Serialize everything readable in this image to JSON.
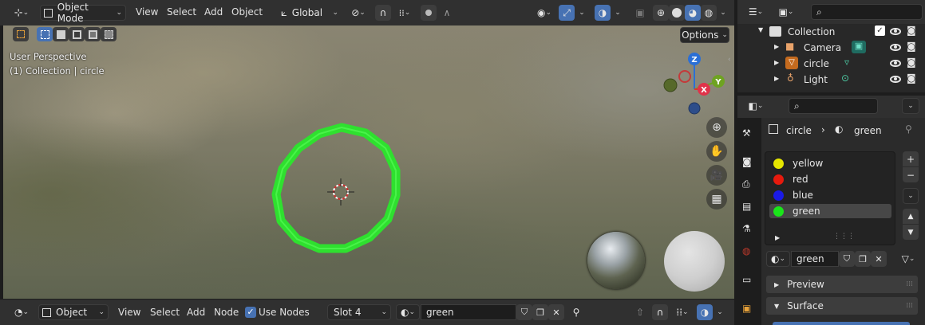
{
  "viewport_header": {
    "mode": "Object Mode",
    "menus": [
      "View",
      "Select",
      "Add",
      "Object"
    ],
    "orientation": "Global",
    "options_label": "Options"
  },
  "viewport": {
    "perspective": "User Perspective",
    "context": "(1) Collection | circle",
    "gizmo": {
      "z": "Z",
      "y": "Y",
      "x": "X"
    }
  },
  "outliner": {
    "root": "Collection",
    "items": [
      {
        "label": "Camera",
        "icon": "camera-icon"
      },
      {
        "label": "circle",
        "icon": "mesh-icon"
      },
      {
        "label": "Light",
        "icon": "light-icon"
      }
    ]
  },
  "properties": {
    "breadcrumb_object": "circle",
    "breadcrumb_material": "green",
    "material_slots": [
      {
        "label": "yellow",
        "color": "#e6e600"
      },
      {
        "label": "red",
        "color": "#e61a0d"
      },
      {
        "label": "blue",
        "color": "#1a1ae6"
      },
      {
        "label": "green",
        "color": "#1ae61a"
      }
    ],
    "active_slot": "green",
    "material_name": "green",
    "panels": [
      "Preview",
      "Surface"
    ]
  },
  "node_header": {
    "editor_type": "Object",
    "menus": [
      "View",
      "Select",
      "Add",
      "Node"
    ],
    "use_nodes_label": "Use Nodes",
    "use_nodes": true,
    "slot": "Slot 4",
    "material": "green"
  },
  "colors": {
    "accent": "#4772b3",
    "circle_mesh": "#2fe02f"
  }
}
